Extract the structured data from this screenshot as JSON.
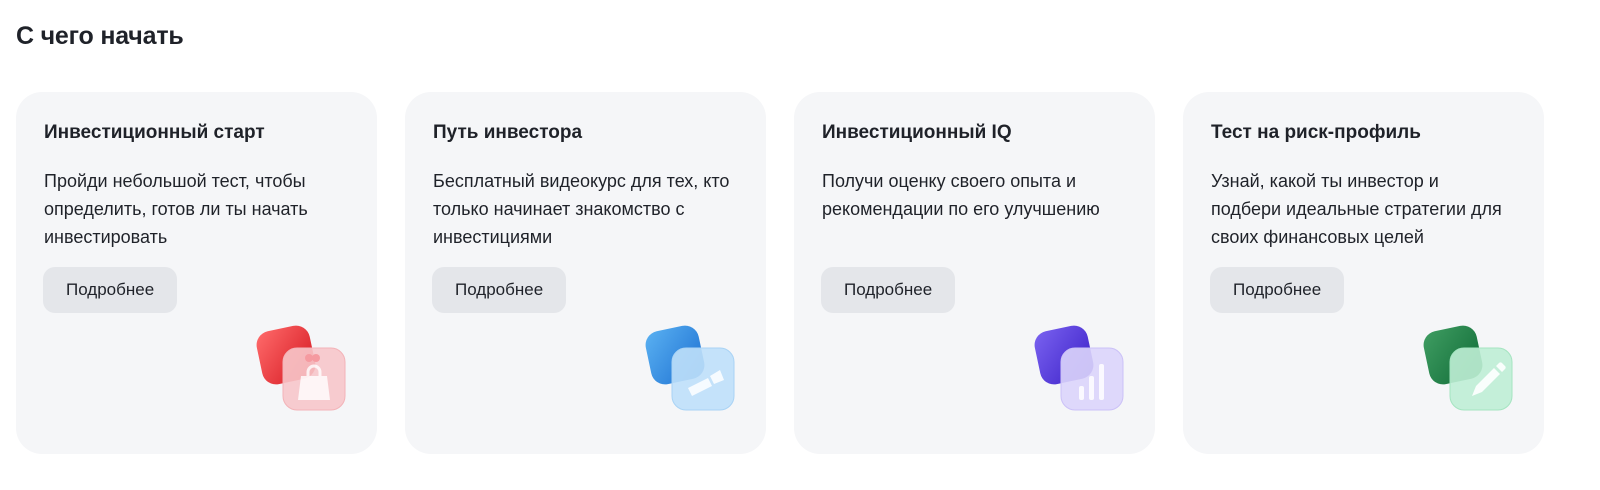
{
  "section": {
    "title": "С чего начать"
  },
  "cards": [
    {
      "title": "Инвестиционный старт",
      "description": "Пройди небольшой тест, чтобы определить, готов ли ты начать инвестировать",
      "button_label": "Подробнее",
      "icon": "shopping-bag-icon",
      "accent": "#e8303a"
    },
    {
      "title": "Путь инвестора",
      "description": "Бесплатный видеокурс для тех, кто только начинает знакомство с инвестициями",
      "button_label": "Подробнее",
      "icon": "video-camera-icon",
      "accent": "#2f8be0"
    },
    {
      "title": "Инвестиционный IQ",
      "description": "Получи оценку своего опыта и рекомендации по его улучшению",
      "button_label": "Подробнее",
      "icon": "bar-chart-icon",
      "accent": "#5a3de0"
    },
    {
      "title": "Тест на риск-профиль",
      "description": "Узнай, какой ты инвестор и подбери идеальные стратегии для своих финансовых целей",
      "button_label": "Подробнее",
      "icon": "pencil-icon",
      "accent": "#1f8a4e"
    }
  ]
}
